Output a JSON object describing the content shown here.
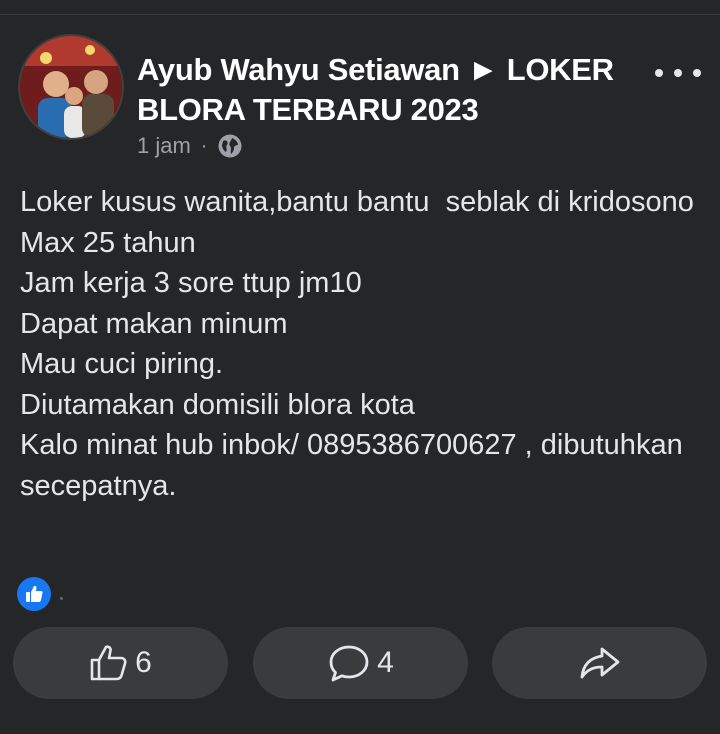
{
  "post": {
    "author_line": "Ayub Wahyu Setiawan ► LOKER BLORA TERBARU 2023",
    "time": "1 jam",
    "separator": "·",
    "audience_icon": "globe-icon",
    "body_lines": [
      "Loker kusus wanita,bantu bantu  seblak di kridosono",
      "Max 25 tahun",
      "Jam kerja 3 sore ttup jm10",
      "Dapat makan minum",
      "Mau cuci piring.",
      "Diutamakan domisili blora kota",
      "Kalo minat hub inbok/ 0895386700627 , dibutuhkan secepatnya."
    ]
  },
  "reactions": {
    "icon": "like-reaction-icon"
  },
  "actions": {
    "like_count": "6",
    "comment_count": "4",
    "share_icon": "share-icon"
  },
  "colors": {
    "background": "#252628",
    "text": "#e4e6eb",
    "muted": "#9ea2a8",
    "button_bg": "#3a3b3d",
    "like_blue": "#1877f2"
  }
}
